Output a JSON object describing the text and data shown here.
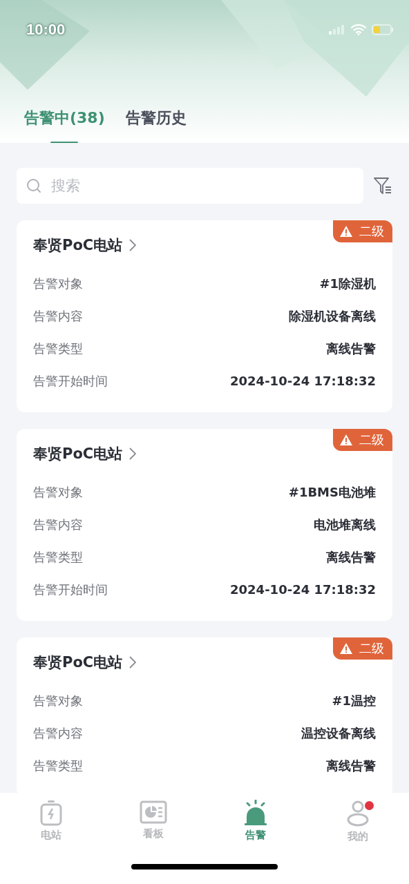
{
  "status_bar": {
    "time": "10:00"
  },
  "tabs": [
    {
      "label": "告警中(38)",
      "selected": true
    },
    {
      "label": "告警历史",
      "selected": false
    }
  ],
  "search": {
    "placeholder": "搜索"
  },
  "alarms": [
    {
      "station": "奉贤PoC电站",
      "level": "二级",
      "rows": [
        {
          "label": "告警对象",
          "value": "#1除湿机"
        },
        {
          "label": "告警内容",
          "value": "除湿机设备离线"
        },
        {
          "label": "告警类型",
          "value": "离线告警"
        },
        {
          "label": "告警开始时间",
          "value": "2024-10-24 17:18:32"
        }
      ]
    },
    {
      "station": "奉贤PoC电站",
      "level": "二级",
      "rows": [
        {
          "label": "告警对象",
          "value": "#1BMS电池堆"
        },
        {
          "label": "告警内容",
          "value": "电池堆离线"
        },
        {
          "label": "告警类型",
          "value": "离线告警"
        },
        {
          "label": "告警开始时间",
          "value": "2024-10-24 17:18:32"
        }
      ]
    },
    {
      "station": "奉贤PoC电站",
      "level": "二级",
      "rows": [
        {
          "label": "告警对象",
          "value": "#1温控"
        },
        {
          "label": "告警内容",
          "value": "温控设备离线"
        },
        {
          "label": "告警类型",
          "value": "离线告警"
        }
      ]
    }
  ],
  "nav": [
    {
      "kind": "station",
      "label": "电站",
      "selected": false,
      "badge": false
    },
    {
      "kind": "board",
      "label": "看板",
      "selected": false,
      "badge": false
    },
    {
      "kind": "alarm",
      "label": "告警",
      "selected": true,
      "badge": false
    },
    {
      "kind": "mine",
      "label": "我的",
      "selected": false,
      "badge": true
    }
  ]
}
